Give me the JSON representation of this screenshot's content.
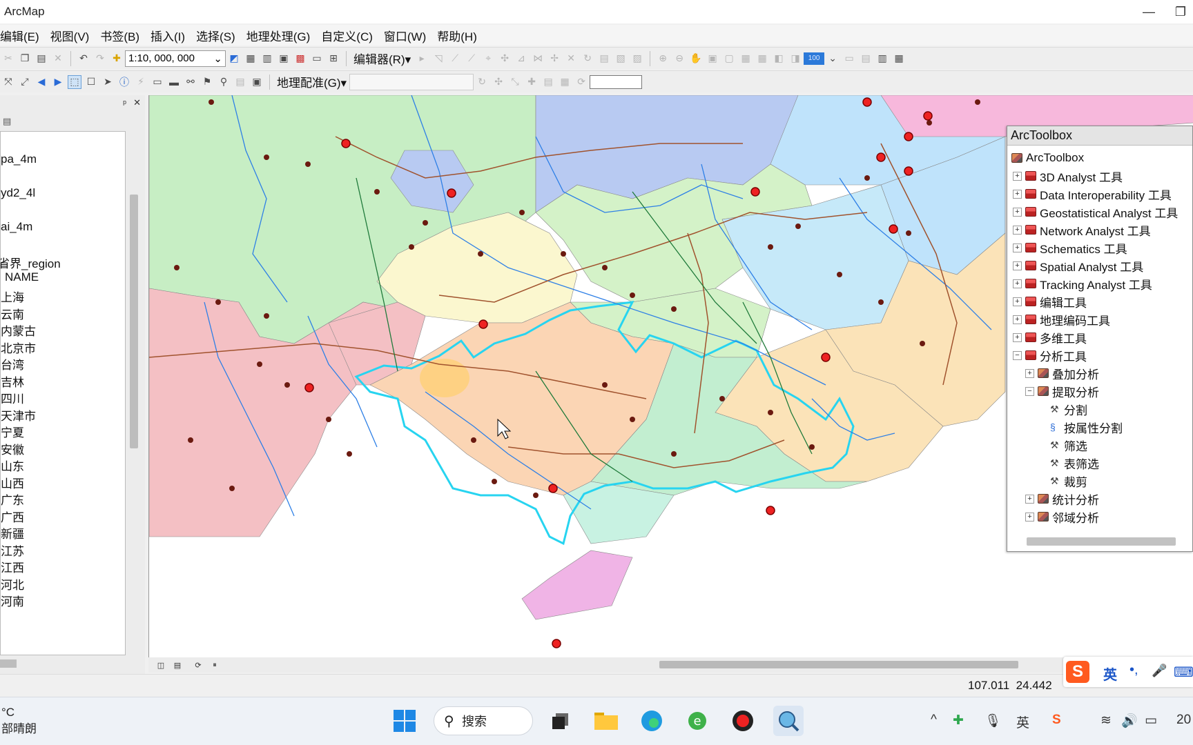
{
  "window": {
    "title": "ArcMap",
    "min": "—",
    "restore": "❐"
  },
  "menu": [
    "编辑(E)",
    "视图(V)",
    "书签(B)",
    "插入(I)",
    "选择(S)",
    "地理处理(G)",
    "自定义(C)",
    "窗口(W)",
    "帮助(H)"
  ],
  "toolbar1": {
    "scale": "1:10, 000, 000",
    "editor_label": "编辑器(R)▾",
    "zoom_value": "100"
  },
  "toolbar2": {
    "georef_label": "地理配准(G)▾"
  },
  "toc": {
    "pin": "ᵖ",
    "close": "✕",
    "layers": [
      "pa_4m",
      "yd2_4l",
      "ai_4m",
      "省界_region"
    ],
    "field": "NAME",
    "values": [
      "上海",
      "云南",
      "内蒙古",
      "北京市",
      "台湾",
      "吉林",
      "四川",
      "天津市",
      "宁夏",
      "安徽",
      "山东",
      "山西",
      "广东",
      "广西",
      "新疆",
      "江苏",
      "江西",
      "河北",
      "河南"
    ]
  },
  "toolbox": {
    "title": "ArcToolbox",
    "root": "ArcToolbox",
    "items": [
      {
        "label": "3D Analyst 工具",
        "expander": "+"
      },
      {
        "label": "Data Interoperability 工具",
        "expander": "+"
      },
      {
        "label": "Geostatistical Analyst 工具",
        "expander": "+"
      },
      {
        "label": "Network Analyst 工具",
        "expander": "+"
      },
      {
        "label": "Schematics 工具",
        "expander": "+"
      },
      {
        "label": "Spatial Analyst 工具",
        "expander": "+"
      },
      {
        "label": "Tracking Analyst 工具",
        "expander": "+"
      },
      {
        "label": "编辑工具",
        "expander": "+"
      },
      {
        "label": "地理编码工具",
        "expander": "+"
      },
      {
        "label": "多维工具",
        "expander": "+"
      },
      {
        "label": "分析工具",
        "expander": "−"
      }
    ],
    "analysis_children": [
      {
        "label": "叠加分析",
        "expander": "+"
      },
      {
        "label": "提取分析",
        "expander": "−"
      }
    ],
    "extract_tools": [
      "分割",
      "按属性分割",
      "筛选",
      "表筛选",
      "裁剪"
    ],
    "more_sets": [
      {
        "label": "统计分析",
        "expander": "+"
      },
      {
        "label": "邻域分析",
        "expander": "+"
      }
    ]
  },
  "status": {
    "x": "107.011",
    "y": "24.442"
  },
  "ime": {
    "logo": "S",
    "mode": "英",
    "punct": "•,",
    "mic": "🎤",
    "kbd": "⌨"
  },
  "taskbar": {
    "weather_temp": "°C",
    "weather_desc": "部晴朗",
    "search": "搜索",
    "tray_caret": "^",
    "tray_lang": "英",
    "clock": "20"
  }
}
